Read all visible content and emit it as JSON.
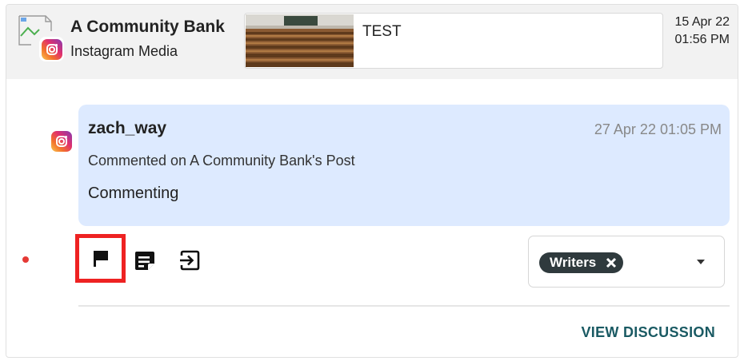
{
  "post": {
    "account_name": "A Community Bank",
    "account_type": "Instagram Media",
    "text": "TEST",
    "date_line1": "15 Apr 22",
    "date_line2": "01:56 PM"
  },
  "comment": {
    "username": "zach_way",
    "timestamp": "27 Apr 22 01:05 PM",
    "context": "Commented on A Community Bank's Post",
    "text": "Commenting"
  },
  "actions": {
    "icons": [
      "flag-icon",
      "note-icon",
      "exit-icon"
    ]
  },
  "tags": {
    "selected": [
      "Writers"
    ]
  },
  "footer": {
    "view_discussion_label": "VIEW DISCUSSION"
  },
  "colors": {
    "bubble": "#ddeaff",
    "flag_highlight": "#ee2222",
    "link": "#1a5a63",
    "chip": "#2f3a3d",
    "unread_dot": "#e53935"
  }
}
